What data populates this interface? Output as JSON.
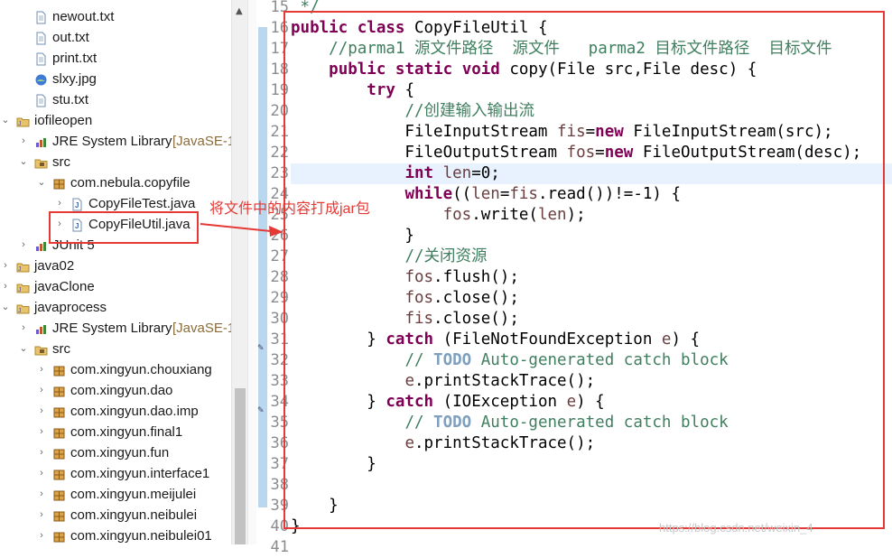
{
  "explorer": {
    "items": [
      {
        "name": "tree-item-newout",
        "label": "newout.txt",
        "sub": "",
        "indent": 1,
        "twisty": "",
        "icon": "file-icon"
      },
      {
        "name": "tree-item-out",
        "label": "out.txt",
        "sub": "",
        "indent": 1,
        "twisty": "",
        "icon": "file-icon"
      },
      {
        "name": "tree-item-print",
        "label": "print.txt",
        "sub": "",
        "indent": 1,
        "twisty": "",
        "icon": "file-icon"
      },
      {
        "name": "tree-item-slxy",
        "label": "slxy.jpg",
        "sub": "",
        "indent": 1,
        "twisty": "",
        "icon": "image-icon"
      },
      {
        "name": "tree-item-stu",
        "label": "stu.txt",
        "sub": "",
        "indent": 1,
        "twisty": "",
        "icon": "file-icon"
      },
      {
        "name": "tree-item-iofileopen",
        "label": "iofileopen",
        "sub": "",
        "indent": 0,
        "twisty": "expanded",
        "icon": "project-icon"
      },
      {
        "name": "tree-item-jre-1",
        "label": "JRE System Library ",
        "sub": "[JavaSE-1",
        "indent": 1,
        "twisty": "collapsed",
        "icon": "library-icon"
      },
      {
        "name": "tree-item-src-1",
        "label": "src",
        "sub": "",
        "indent": 1,
        "twisty": "expanded",
        "icon": "source-folder-icon"
      },
      {
        "name": "tree-item-pkg-copyfile",
        "label": "com.nebula.copyfile",
        "sub": "",
        "indent": 2,
        "twisty": "expanded",
        "icon": "package-icon"
      },
      {
        "name": "tree-item-copyfiletest",
        "label": "CopyFileTest.java",
        "sub": "",
        "indent": 3,
        "twisty": "collapsed",
        "icon": "java-file-icon"
      },
      {
        "name": "tree-item-copyfileutil",
        "label": "CopyFileUtil.java",
        "sub": "",
        "indent": 3,
        "twisty": "collapsed",
        "icon": "java-file-icon"
      },
      {
        "name": "tree-item-junit5",
        "label": "JUnit 5",
        "sub": "",
        "indent": 1,
        "twisty": "collapsed",
        "icon": "library-icon"
      },
      {
        "name": "tree-item-java02",
        "label": "java02",
        "sub": "",
        "indent": 0,
        "twisty": "collapsed",
        "icon": "project-icon"
      },
      {
        "name": "tree-item-javaclone",
        "label": "javaClone",
        "sub": "",
        "indent": 0,
        "twisty": "collapsed",
        "icon": "project-icon"
      },
      {
        "name": "tree-item-javaprocess",
        "label": "javaprocess",
        "sub": "",
        "indent": 0,
        "twisty": "expanded",
        "icon": "project-icon"
      },
      {
        "name": "tree-item-jre-2",
        "label": "JRE System Library ",
        "sub": "[JavaSE-1",
        "indent": 1,
        "twisty": "collapsed",
        "icon": "library-icon"
      },
      {
        "name": "tree-item-src-2",
        "label": "src",
        "sub": "",
        "indent": 1,
        "twisty": "expanded",
        "icon": "source-folder-icon"
      },
      {
        "name": "tree-item-pkg-chouxiang",
        "label": "com.xingyun.chouxiang",
        "sub": "",
        "indent": 2,
        "twisty": "collapsed",
        "icon": "package-icon"
      },
      {
        "name": "tree-item-pkg-dao",
        "label": "com.xingyun.dao",
        "sub": "",
        "indent": 2,
        "twisty": "collapsed",
        "icon": "package-icon"
      },
      {
        "name": "tree-item-pkg-daoimp",
        "label": "com.xingyun.dao.imp",
        "sub": "",
        "indent": 2,
        "twisty": "collapsed",
        "icon": "package-icon"
      },
      {
        "name": "tree-item-pkg-final1",
        "label": "com.xingyun.final1",
        "sub": "",
        "indent": 2,
        "twisty": "collapsed",
        "icon": "package-icon"
      },
      {
        "name": "tree-item-pkg-fun",
        "label": "com.xingyun.fun",
        "sub": "",
        "indent": 2,
        "twisty": "collapsed",
        "icon": "package-icon"
      },
      {
        "name": "tree-item-pkg-interface1",
        "label": "com.xingyun.interface1",
        "sub": "",
        "indent": 2,
        "twisty": "collapsed",
        "icon": "package-icon"
      },
      {
        "name": "tree-item-pkg-meijulei",
        "label": "com.xingyun.meijulei",
        "sub": "",
        "indent": 2,
        "twisty": "collapsed",
        "icon": "package-icon"
      },
      {
        "name": "tree-item-pkg-neibulei",
        "label": "com.xingyun.neibulei",
        "sub": "",
        "indent": 2,
        "twisty": "collapsed",
        "icon": "package-icon"
      },
      {
        "name": "tree-item-pkg-neibulei01",
        "label": "com.xingyun.neibulei01",
        "sub": "",
        "indent": 2,
        "twisty": "collapsed",
        "icon": "package-icon"
      }
    ]
  },
  "editor": {
    "lines": [
      {
        "n": "15",
        "highlight": false,
        "tokens": [
          {
            "c": "cm",
            "t": " */"
          }
        ]
      },
      {
        "n": "16",
        "highlight": false,
        "tokens": [
          {
            "c": "kw",
            "t": "public"
          },
          {
            "c": "",
            "t": " "
          },
          {
            "c": "kw",
            "t": "class"
          },
          {
            "c": "",
            "t": " CopyFileUtil {"
          }
        ]
      },
      {
        "n": "17",
        "highlight": false,
        "tokens": [
          {
            "c": "",
            "t": "    "
          },
          {
            "c": "cm",
            "t": "//parma1 源文件路径  源文件   parma2 目标文件路径  目标文件"
          }
        ]
      },
      {
        "n": "18",
        "highlight": false,
        "tokens": [
          {
            "c": "",
            "t": "    "
          },
          {
            "c": "kw",
            "t": "public"
          },
          {
            "c": "",
            "t": " "
          },
          {
            "c": "kw",
            "t": "static"
          },
          {
            "c": "",
            "t": " "
          },
          {
            "c": "kw",
            "t": "void"
          },
          {
            "c": "",
            "t": " copy(File src,File desc) {"
          }
        ]
      },
      {
        "n": "19",
        "highlight": false,
        "tokens": [
          {
            "c": "",
            "t": "        "
          },
          {
            "c": "kw",
            "t": "try"
          },
          {
            "c": "",
            "t": " {"
          }
        ]
      },
      {
        "n": "20",
        "highlight": false,
        "tokens": [
          {
            "c": "",
            "t": "            "
          },
          {
            "c": "cm",
            "t": "//创建输入输出流"
          }
        ]
      },
      {
        "n": "21",
        "highlight": false,
        "tokens": [
          {
            "c": "",
            "t": "            FileInputStream "
          },
          {
            "c": "var",
            "t": "fis"
          },
          {
            "c": "",
            "t": "="
          },
          {
            "c": "kw",
            "t": "new"
          },
          {
            "c": "",
            "t": " FileInputStream(src);"
          }
        ]
      },
      {
        "n": "22",
        "highlight": false,
        "tokens": [
          {
            "c": "",
            "t": "            FileOutputStream "
          },
          {
            "c": "var",
            "t": "fos"
          },
          {
            "c": "",
            "t": "="
          },
          {
            "c": "kw",
            "t": "new"
          },
          {
            "c": "",
            "t": " FileOutputStream(desc);"
          }
        ]
      },
      {
        "n": "23",
        "highlight": true,
        "tokens": [
          {
            "c": "",
            "t": "            "
          },
          {
            "c": "kw",
            "t": "int"
          },
          {
            "c": "",
            "t": " "
          },
          {
            "c": "var",
            "t": "len"
          },
          {
            "c": "",
            "t": "=0;"
          }
        ]
      },
      {
        "n": "24",
        "highlight": false,
        "tokens": [
          {
            "c": "",
            "t": "            "
          },
          {
            "c": "kw",
            "t": "while"
          },
          {
            "c": "",
            "t": "(("
          },
          {
            "c": "var",
            "t": "len"
          },
          {
            "c": "",
            "t": "="
          },
          {
            "c": "var",
            "t": "fis"
          },
          {
            "c": "",
            "t": ".read())!=-1) {"
          }
        ]
      },
      {
        "n": "25",
        "highlight": false,
        "tokens": [
          {
            "c": "",
            "t": "                "
          },
          {
            "c": "var",
            "t": "fos"
          },
          {
            "c": "",
            "t": ".write("
          },
          {
            "c": "var",
            "t": "len"
          },
          {
            "c": "",
            "t": ");"
          }
        ]
      },
      {
        "n": "26",
        "highlight": false,
        "tokens": [
          {
            "c": "",
            "t": "            }"
          }
        ]
      },
      {
        "n": "27",
        "highlight": false,
        "tokens": [
          {
            "c": "",
            "t": "            "
          },
          {
            "c": "cm",
            "t": "//关闭资源"
          }
        ]
      },
      {
        "n": "28",
        "highlight": false,
        "tokens": [
          {
            "c": "",
            "t": "            "
          },
          {
            "c": "var",
            "t": "fos"
          },
          {
            "c": "",
            "t": ".flush();"
          }
        ]
      },
      {
        "n": "29",
        "highlight": false,
        "tokens": [
          {
            "c": "",
            "t": "            "
          },
          {
            "c": "var",
            "t": "fos"
          },
          {
            "c": "",
            "t": ".close();"
          }
        ]
      },
      {
        "n": "30",
        "highlight": false,
        "tokens": [
          {
            "c": "",
            "t": "            "
          },
          {
            "c": "var",
            "t": "fis"
          },
          {
            "c": "",
            "t": ".close();"
          }
        ]
      },
      {
        "n": "31",
        "highlight": false,
        "tokens": [
          {
            "c": "",
            "t": "        } "
          },
          {
            "c": "kw",
            "t": "catch"
          },
          {
            "c": "",
            "t": " (FileNotFoundException "
          },
          {
            "c": "var",
            "t": "e"
          },
          {
            "c": "",
            "t": ") {"
          }
        ]
      },
      {
        "n": "32",
        "highlight": false,
        "tokens": [
          {
            "c": "",
            "t": "            "
          },
          {
            "c": "cm",
            "t": "// "
          },
          {
            "c": "todo",
            "t": "TODO"
          },
          {
            "c": "cm",
            "t": " Auto-generated catch block"
          }
        ]
      },
      {
        "n": "33",
        "highlight": false,
        "tokens": [
          {
            "c": "",
            "t": "            "
          },
          {
            "c": "var",
            "t": "e"
          },
          {
            "c": "",
            "t": ".printStackTrace();"
          }
        ]
      },
      {
        "n": "34",
        "highlight": false,
        "tokens": [
          {
            "c": "",
            "t": "        } "
          },
          {
            "c": "kw",
            "t": "catch"
          },
          {
            "c": "",
            "t": " (IOException "
          },
          {
            "c": "var",
            "t": "e"
          },
          {
            "c": "",
            "t": ") {"
          }
        ]
      },
      {
        "n": "35",
        "highlight": false,
        "tokens": [
          {
            "c": "",
            "t": "            "
          },
          {
            "c": "cm",
            "t": "// "
          },
          {
            "c": "todo",
            "t": "TODO"
          },
          {
            "c": "cm",
            "t": " Auto-generated catch block"
          }
        ]
      },
      {
        "n": "36",
        "highlight": false,
        "tokens": [
          {
            "c": "",
            "t": "            "
          },
          {
            "c": "var",
            "t": "e"
          },
          {
            "c": "",
            "t": ".printStackTrace();"
          }
        ]
      },
      {
        "n": "37",
        "highlight": false,
        "tokens": [
          {
            "c": "",
            "t": "        }"
          }
        ]
      },
      {
        "n": "38",
        "highlight": false,
        "tokens": []
      },
      {
        "n": "39",
        "highlight": false,
        "tokens": [
          {
            "c": "",
            "t": "    }"
          }
        ]
      },
      {
        "n": "40",
        "highlight": false,
        "tokens": [
          {
            "c": "",
            "t": "}"
          }
        ]
      },
      {
        "n": "41",
        "highlight": false,
        "tokens": []
      }
    ]
  },
  "annotation": {
    "text": "将文件中的内容打成jar包",
    "color": "#e53935"
  },
  "watermark": "https://blog.csdn.net/weixin_4"
}
